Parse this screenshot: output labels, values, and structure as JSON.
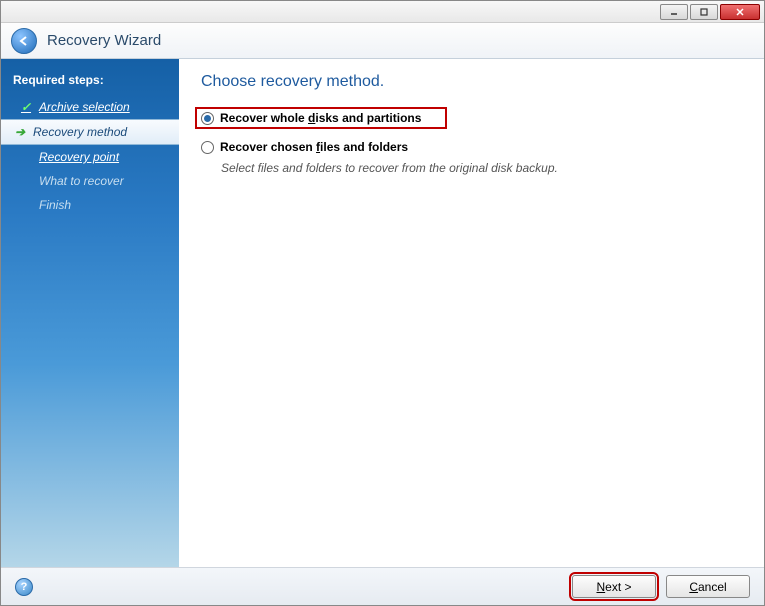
{
  "window": {
    "title": "Recovery Wizard"
  },
  "sidebar": {
    "heading": "Required steps:",
    "steps": [
      {
        "label": "Archive selection",
        "state": "completed"
      },
      {
        "label": "Recovery method",
        "state": "current"
      },
      {
        "label": "Recovery point",
        "state": "pending"
      },
      {
        "label": "What to recover",
        "state": "disabled"
      },
      {
        "label": "Finish",
        "state": "disabled"
      }
    ]
  },
  "main": {
    "title": "Choose recovery method.",
    "options": [
      {
        "label_pre": "Recover whole ",
        "label_ul": "d",
        "label_post": "isks and partitions",
        "selected": true,
        "highlighted": true,
        "description": ""
      },
      {
        "label_pre": "Recover chosen ",
        "label_ul": "f",
        "label_post": "iles and folders",
        "selected": false,
        "highlighted": false,
        "description": "Select files and folders to recover from the original disk backup."
      }
    ]
  },
  "footer": {
    "next_pre": "",
    "next_ul": "N",
    "next_post": "ext >",
    "cancel_pre": "",
    "cancel_ul": "C",
    "cancel_post": "ancel"
  }
}
